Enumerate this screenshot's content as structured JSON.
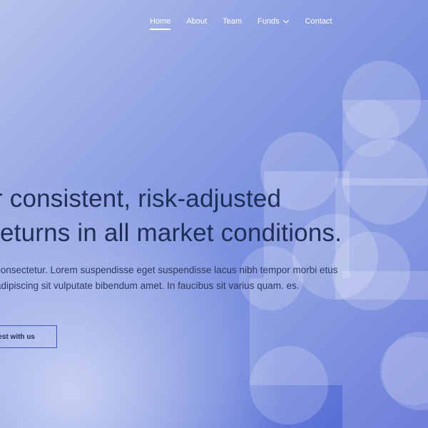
{
  "nav": {
    "items": [
      {
        "label": "Home",
        "active": true
      },
      {
        "label": "About"
      },
      {
        "label": "Team"
      },
      {
        "label": "Funds",
        "has_dropdown": true
      },
      {
        "label": "Contact"
      }
    ]
  },
  "hero": {
    "headline_line1": "r consistent, risk-adjusted",
    "headline_line2": "eturns in all market conditions.",
    "paragraph": "consectetur. Lorem suspendisse eget suspendisse lacus nibh tempor morbi etus adipiscing sit vulputate bibendum amet. In faucibus sit varius quam. es.",
    "cta_label": "vest with us"
  },
  "colors": {
    "headline": "#1e2f57",
    "accent": "#3b56c9",
    "nav_text": "#ffffff"
  },
  "icons": {
    "funds_dropdown": "chevron-down-icon"
  }
}
